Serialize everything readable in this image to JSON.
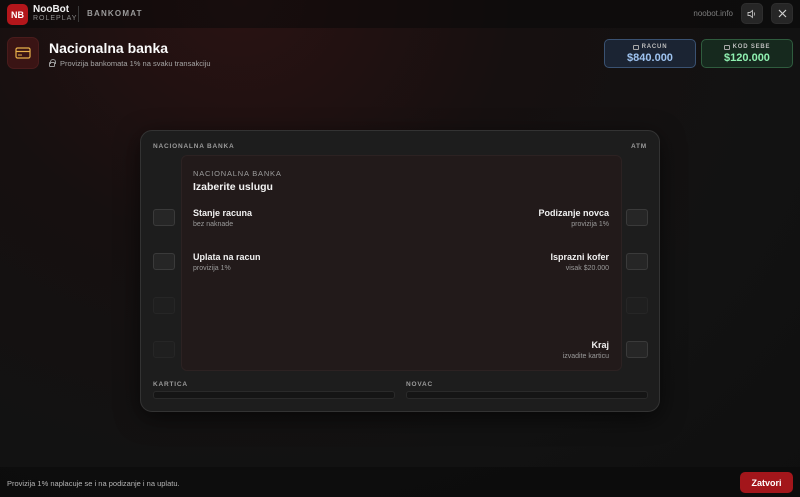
{
  "topbar": {
    "logo": "NB",
    "brand_name": "NooBot",
    "brand_sub": "ROLEPLAY",
    "section": "BANKOMAT",
    "site": "noobot.info",
    "sound_icon": "speaker-icon",
    "close_icon": "close-icon"
  },
  "header": {
    "icon": "credit-card-icon",
    "title": "Nacionalna banka",
    "subtitle": "Provizija bankomata 1% na svaku transakciju",
    "balances": {
      "bank_label": "RACUN",
      "bank_value": "$840.000",
      "cash_label": "KOD SEBE",
      "cash_value": "$120.000"
    }
  },
  "atm": {
    "label_left": "NACIONALNA BANKA",
    "label_right": "ATM",
    "screen": {
      "brand": "NACIONALNA BANKA",
      "title": "Izaberite uslugu",
      "options": [
        {
          "title": "Stanje racuna",
          "sub": "bez naknade"
        },
        {
          "title": "Podizanje novca",
          "sub": "provizija 1%"
        },
        {
          "title": "Uplata na racun",
          "sub": "provizija 1%"
        },
        {
          "title": "Isprazni kofer",
          "sub": "visak $20.000"
        },
        {
          "title": "Kraj",
          "sub": "izvadite karticu"
        }
      ]
    },
    "card_label": "KARTICA",
    "cash_label": "NOVAC"
  },
  "footer": {
    "note": "Provizija 1% naplacuje se i na podizanje i na uplatu.",
    "close_label": "Zatvori"
  },
  "colors": {
    "accent": "#b3161b",
    "bank": "#9ec3f0",
    "cash": "#8ff0b0"
  }
}
